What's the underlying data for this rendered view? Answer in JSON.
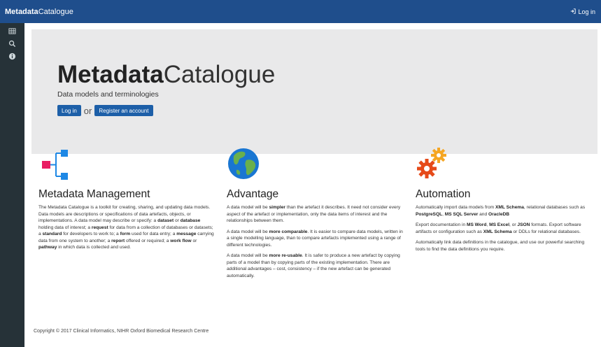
{
  "header": {
    "brand_bold": "Metadata",
    "brand_light": "Catalogue",
    "login_label": "Log in",
    "bar_color": "#1f4e8c"
  },
  "sidebar": {
    "items": [
      {
        "icon": "table-icon"
      },
      {
        "icon": "search-icon"
      },
      {
        "icon": "info-icon"
      }
    ]
  },
  "hero": {
    "title_bold": "Metadata",
    "title_light": "Catalogue",
    "subtitle": "Data models and terminologies",
    "login_button": "Log in",
    "or_text": "or",
    "register_button": "Register an account"
  },
  "features": [
    {
      "icon": "hierarchy-icon",
      "title": "Metadata Management",
      "paragraphs": [
        [
          {
            "t": "The Metadata Catalogue is a toolkit for creating, sharing, and updating data models."
          },
          {
            "t": " Data models are descriptions or specifications of data artefacts, objects, or implementations. A data model may describe or specify: a "
          },
          {
            "t": "dataset",
            "b": true
          },
          {
            "t": " or "
          },
          {
            "t": "database",
            "b": true
          },
          {
            "t": " holding data of interest; a "
          },
          {
            "t": "request",
            "b": true
          },
          {
            "t": " for data from a collection of databases or datasets; a "
          },
          {
            "t": "standard",
            "b": true
          },
          {
            "t": " for developers to work to; a "
          },
          {
            "t": "form",
            "b": true
          },
          {
            "t": " used for data entry; a "
          },
          {
            "t": "message",
            "b": true
          },
          {
            "t": " carrying data from one system to another; a "
          },
          {
            "t": "report",
            "b": true
          },
          {
            "t": " offered or required; a "
          },
          {
            "t": "work flow",
            "b": true
          },
          {
            "t": " or "
          },
          {
            "t": "pathway",
            "b": true
          },
          {
            "t": " in which data is collected and used."
          }
        ]
      ]
    },
    {
      "icon": "globe-icon",
      "title": "Advantage",
      "paragraphs": [
        [
          {
            "t": "A data model will be "
          },
          {
            "t": "simpler",
            "b": true
          },
          {
            "t": " than the artefact it describes. It need not consider every aspect of the artefact or implementation, only the data items of interest and the relationships between them."
          }
        ],
        [
          {
            "t": "A data model will be "
          },
          {
            "t": "more comparable",
            "b": true
          },
          {
            "t": ". It is easier to compare data models, written in a single modelling language, than to compare artefacts implemented using a range of different technologies."
          }
        ],
        [
          {
            "t": "A data model will be "
          },
          {
            "t": "more re-usable",
            "b": true
          },
          {
            "t": ". It is safer to produce a new artefact by copying parts of a model than by copying parts of the existing implementation. There are additional advantages – cost, consistency – if the new artefact can be generated automatically."
          }
        ]
      ]
    },
    {
      "icon": "gears-icon",
      "title": "Automation",
      "paragraphs": [
        [
          {
            "t": "Automatically import data models from "
          },
          {
            "t": "XML Schema",
            "b": true
          },
          {
            "t": ", relational databases such as "
          },
          {
            "t": "PostgreSQL",
            "b": true
          },
          {
            "t": ", "
          },
          {
            "t": "MS SQL Server",
            "b": true
          },
          {
            "t": " and "
          },
          {
            "t": "OracleDB",
            "b": true
          }
        ],
        [
          {
            "t": "Export documentation in "
          },
          {
            "t": "MS Word",
            "b": true
          },
          {
            "t": ", "
          },
          {
            "t": "MS Excel",
            "b": true
          },
          {
            "t": ", or "
          },
          {
            "t": "JSON",
            "b": true
          },
          {
            "t": " formats. Export software artifacts or configuration such as "
          },
          {
            "t": "XML Schema",
            "b": true
          },
          {
            "t": " or DDLs for relational databases."
          }
        ],
        [
          {
            "t": "Automatically link data definitions in the catalogue, and use our powerful searching tools to find the data definitions you require."
          }
        ]
      ]
    }
  ],
  "footer": {
    "copyright": "Copyright © 2017 Clinical Informatics, NIHR Oxford Biomedical Research Centre"
  }
}
